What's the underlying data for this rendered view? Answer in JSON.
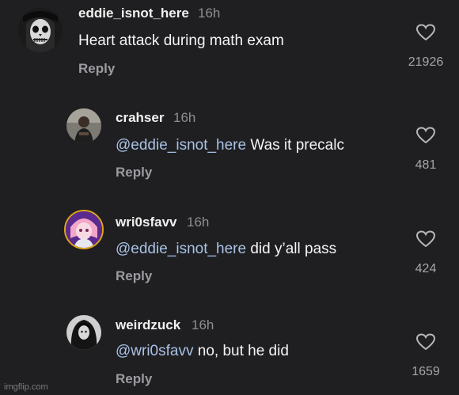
{
  "comments": [
    {
      "username": "eddie_isnot_here",
      "time": "16h",
      "mention": "",
      "text": "Heart attack during math exam",
      "reply": "Reply",
      "likes": "21926",
      "avatar_icon": "skull-face-avatar"
    },
    {
      "username": "crahser",
      "time": "16h",
      "mention": "@eddie_isnot_here",
      "text": " Was it precalc",
      "reply": "Reply",
      "likes": "481",
      "avatar_icon": "person-photo-avatar"
    },
    {
      "username": "wri0sfavv",
      "time": "16h",
      "mention": "@eddie_isnot_here",
      "text": " did y’all pass",
      "reply": "Reply",
      "likes": "424",
      "avatar_icon": "anime-character-avatar"
    },
    {
      "username": "weirdzuck",
      "time": "16h",
      "mention": "@wri0sfavv",
      "text": " no, but he did",
      "reply": "Reply",
      "likes": "1659",
      "avatar_icon": "dark-photo-avatar"
    }
  ],
  "watermark": "imgflip.com",
  "colors": {
    "background": "#1f1f21",
    "mention": "#a9c2e6",
    "muted": "#8e8e93"
  }
}
